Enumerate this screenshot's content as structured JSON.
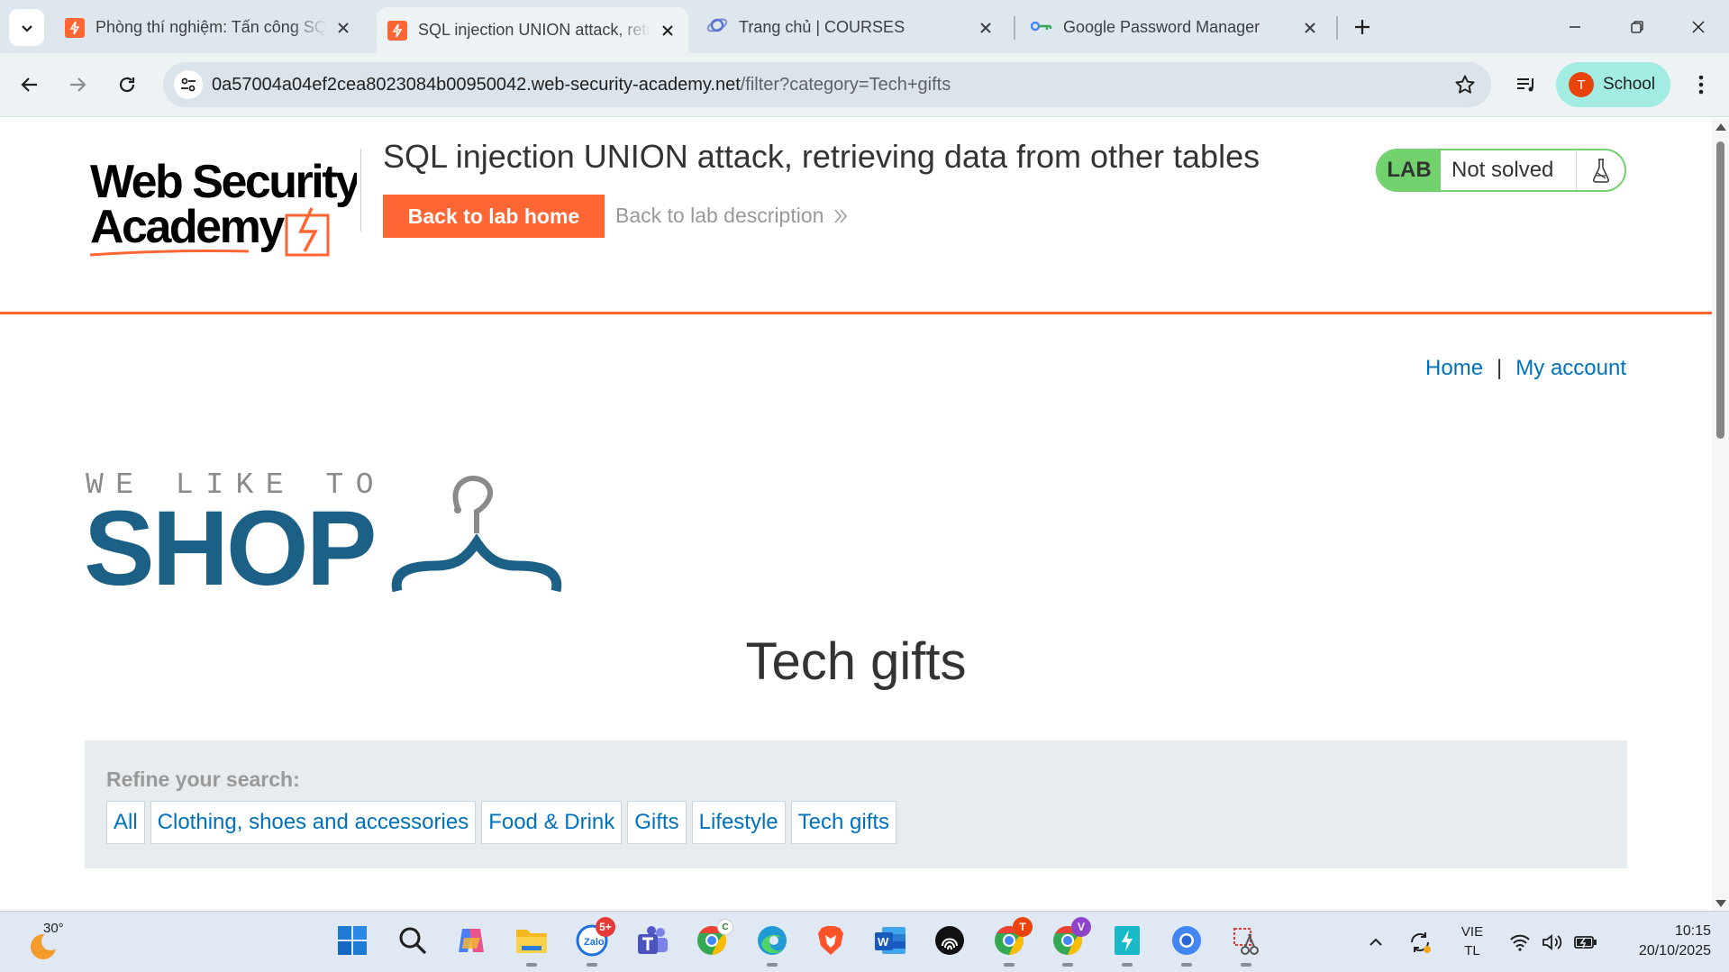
{
  "browser": {
    "tabs": [
      {
        "title": "Phòng thí nghiệm: Tấn công SQL injection",
        "favicon": "wsa-lightning-icon",
        "active": false
      },
      {
        "title": "SQL injection UNION attack, retrieving data from other tables",
        "favicon": "wsa-lightning-icon",
        "active": true
      },
      {
        "title": "Trang chủ | COURSES",
        "favicon": "ie-courses-icon",
        "active": false
      },
      {
        "title": "Google Password Manager",
        "favicon": "key-icon",
        "active": false
      }
    ],
    "address": {
      "host": "0a57004a04ef2cea8023084b00950042.web-security-academy.net",
      "path": "/filter?category=Tech+gifts"
    },
    "profile": {
      "initial": "T",
      "label": "School"
    }
  },
  "header": {
    "logo_line1": "Web Security",
    "logo_line2": "Academy",
    "lab_title": "SQL injection UNION attack, retrieving data from other tables",
    "back_home": "Back to lab home",
    "back_description": "Back to lab description",
    "lab_badge": "LAB",
    "lab_status": "Not solved"
  },
  "nav": {
    "home": "Home",
    "separator": "|",
    "account": "My account"
  },
  "shop_logo": {
    "tagline": "WE LIKE TO",
    "word": "SHOP"
  },
  "category_heading": "Tech gifts",
  "filter": {
    "label": "Refine your search:",
    "categories": [
      "All",
      "Clothing, shoes and accessories",
      "Food & Drink",
      "Gifts",
      "Lifestyle",
      "Tech gifts"
    ]
  },
  "taskbar": {
    "temperature": "30°",
    "zalo_badge": "5+",
    "chrome_profile_1_badge": "T",
    "chrome_profile_2_badge": "V",
    "language_line1": "VIE",
    "language_line2": "TL",
    "time": "10:15",
    "date": "20/10/2025"
  },
  "colors": {
    "accent": "#ff6633",
    "link": "#0071bc",
    "lab_green": "#70d16d",
    "shop_blue": "#1c6185"
  }
}
